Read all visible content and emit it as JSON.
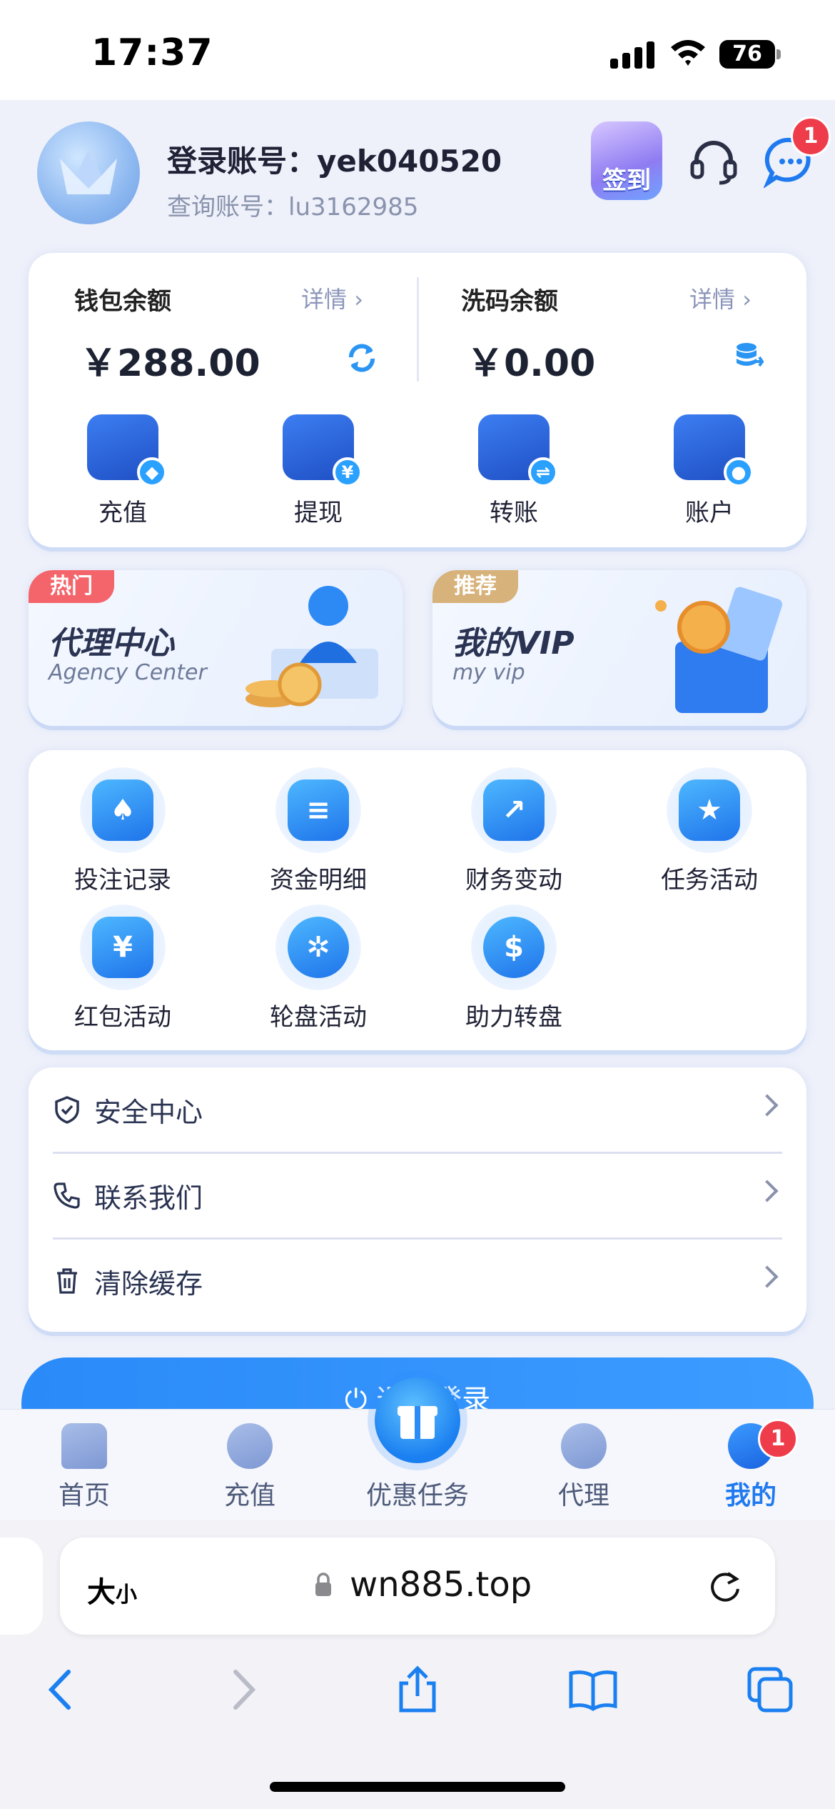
{
  "status_bar": {
    "time": "17:37",
    "battery": "76"
  },
  "header": {
    "login_account": "登录账号：yek040520",
    "query_account": "查询账号：lu3162985",
    "signin_label": "签到",
    "chat_badge": "1"
  },
  "wallet": {
    "left": {
      "title": "钱包余额",
      "detail": "详情",
      "amount": "￥288.00"
    },
    "right": {
      "title": "洗码余额",
      "detail": "详情",
      "amount": "￥0.00"
    },
    "actions": [
      {
        "label": "充值",
        "icon": "wallet-icon"
      },
      {
        "label": "提现",
        "icon": "card-icon"
      },
      {
        "label": "转账",
        "icon": "transfer-icon"
      },
      {
        "label": "账户",
        "icon": "account-icon"
      }
    ]
  },
  "promos": [
    {
      "tag": "热门",
      "title": "代理中心",
      "subtitle": "Agency Center"
    },
    {
      "tag": "推荐",
      "title": "我的VIP",
      "subtitle": "my vip"
    }
  ],
  "grid": [
    {
      "label": "投注记录",
      "icon": "bet-record-icon"
    },
    {
      "label": "资金明细",
      "icon": "fund-detail-icon"
    },
    {
      "label": "财务变动",
      "icon": "finance-change-icon"
    },
    {
      "label": "任务活动",
      "icon": "task-activity-icon"
    },
    {
      "label": "红包活动",
      "icon": "red-packet-icon"
    },
    {
      "label": "轮盘活动",
      "icon": "roulette-icon"
    },
    {
      "label": "助力转盘",
      "icon": "assist-wheel-icon"
    }
  ],
  "list": [
    {
      "label": "安全中心",
      "icon": "shield-icon"
    },
    {
      "label": "联系我们",
      "icon": "phone-icon"
    },
    {
      "label": "清除缓存",
      "icon": "trash-icon"
    }
  ],
  "logout_label": "退出登录",
  "tabs": [
    {
      "label": "首页"
    },
    {
      "label": "充值"
    },
    {
      "label": "优惠任务"
    },
    {
      "label": "代理"
    },
    {
      "label": "我的"
    }
  ],
  "me_badge": "1",
  "browser": {
    "text_size": "大",
    "text_size_small": "小",
    "url": "wn885.top"
  },
  "colors": {
    "accent": "#1f7af0",
    "badge": "#ef3c4a",
    "hot_tag": "#f4646b",
    "recommend_tag": "#d7b27a"
  }
}
